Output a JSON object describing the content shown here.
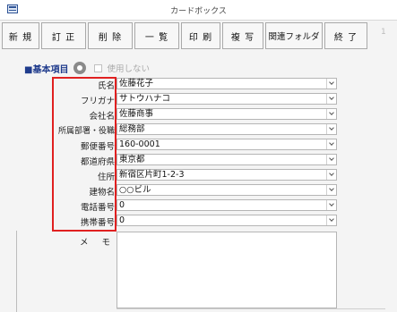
{
  "window": {
    "title": "カードボックス",
    "side_number": "1"
  },
  "toolbar": {
    "buttons": [
      {
        "label": "新 規"
      },
      {
        "label": "訂 正"
      },
      {
        "label": "削 除"
      },
      {
        "label": "一 覧"
      },
      {
        "label": "印 刷"
      },
      {
        "label": "複 写"
      },
      {
        "label": "関連フォルダ"
      },
      {
        "label": "終 了"
      }
    ]
  },
  "section": {
    "title": "■基本項目",
    "checkbox_label": "使用しない",
    "checkbox_checked": false
  },
  "fields": [
    {
      "label": "氏名",
      "value": "佐藤花子"
    },
    {
      "label": "フリガナ",
      "value": "サトウハナコ"
    },
    {
      "label": "会社名",
      "value": "佐藤商事"
    },
    {
      "label": "所属部署・役職",
      "value": "総務部"
    },
    {
      "label": "郵便番号",
      "value": "160-0001"
    },
    {
      "label": "都道府県",
      "value": "東京都"
    },
    {
      "label": "住所",
      "value": "新宿区片町1-2-3"
    },
    {
      "label": "建物名",
      "value": "○○ビル"
    },
    {
      "label": "電話番号",
      "value": "0"
    },
    {
      "label": "携帯番号",
      "value": "0"
    }
  ],
  "memo": {
    "label": "メ モ",
    "value": ""
  },
  "colors": {
    "highlight_frame": "#e02020",
    "section_title": "#1f3b8c"
  }
}
